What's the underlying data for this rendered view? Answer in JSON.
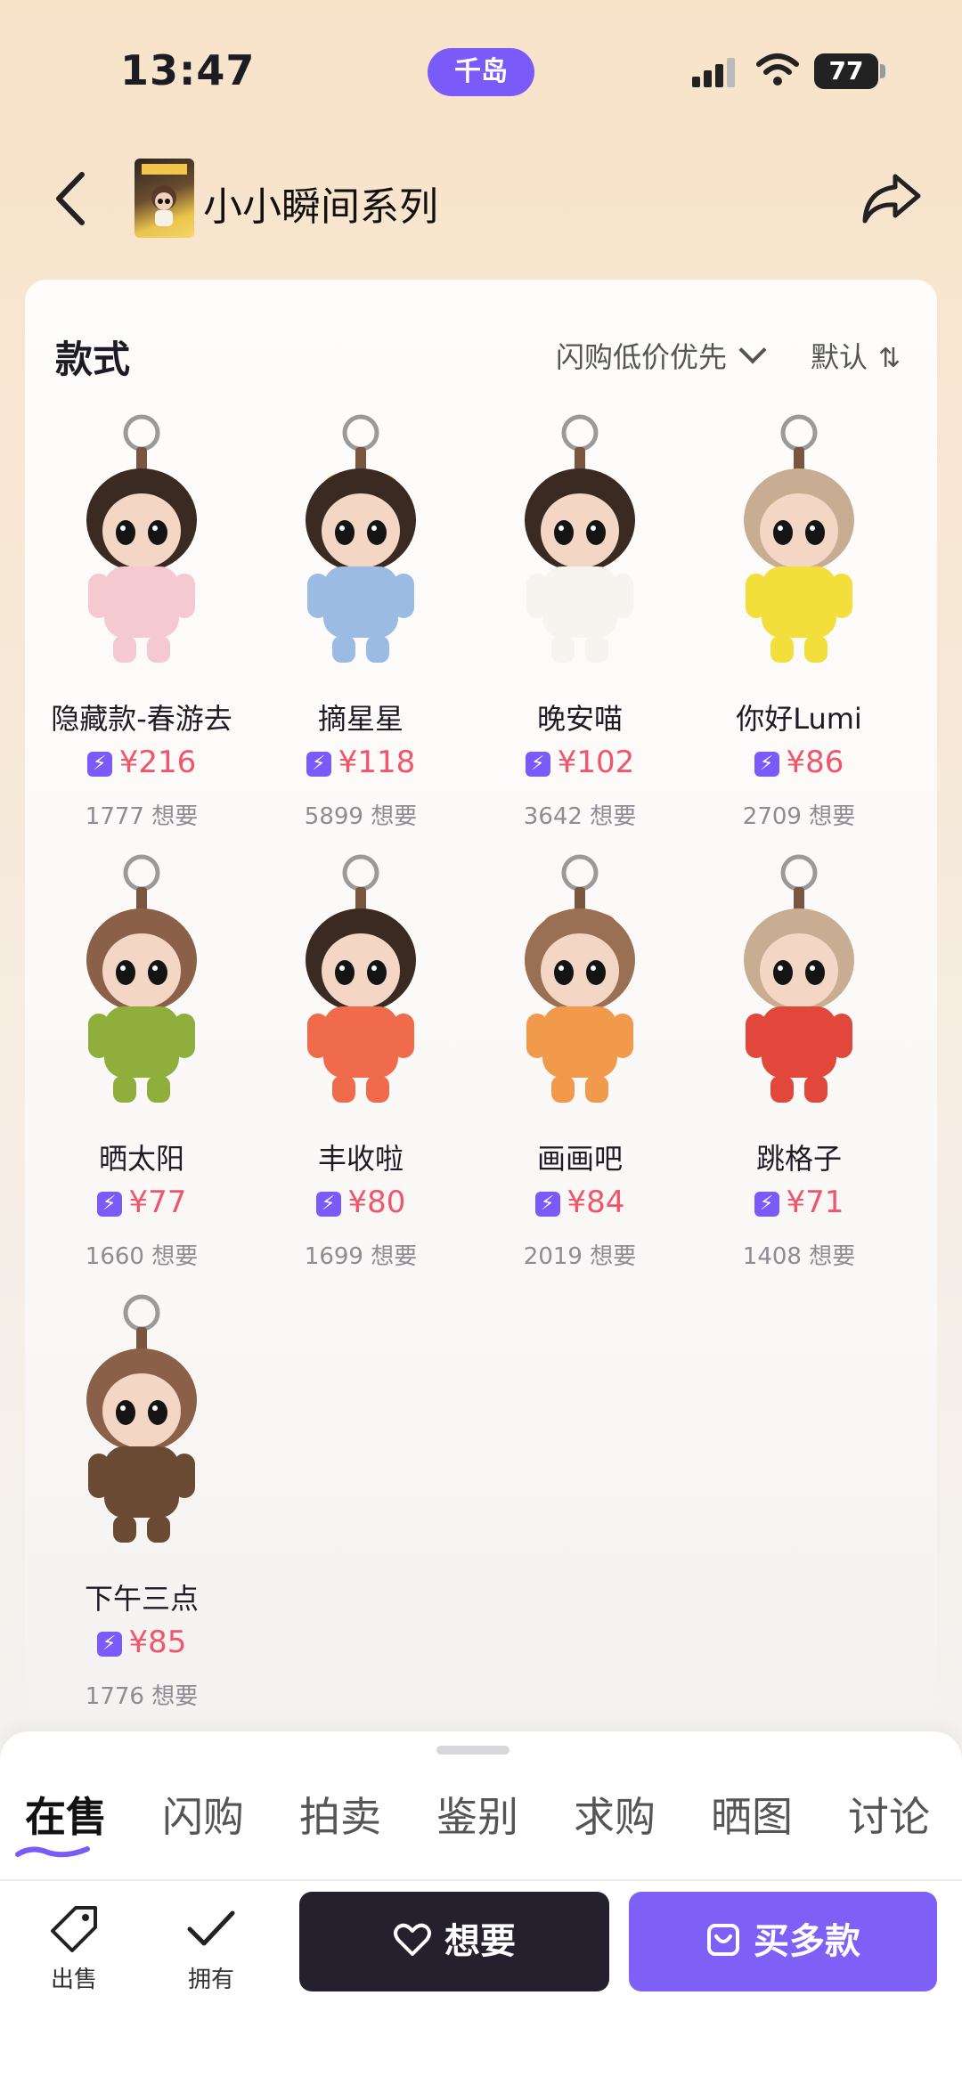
{
  "status_bar": {
    "time": "13:47",
    "app_pill": "千岛",
    "battery": "77"
  },
  "header": {
    "title": "小小瞬间系列"
  },
  "section": {
    "title": "款式",
    "sort_flash_label": "闪购低价优先",
    "sort_default_label": "默认",
    "sort_default_icon": "⇅"
  },
  "items": [
    {
      "name": "隐藏款-春游去",
      "price": "¥216",
      "wants": "1777 想要",
      "hair": "#3b2a22",
      "outfit": "#f4c9d2",
      "hat": "#ffffff"
    },
    {
      "name": "摘星星",
      "price": "¥118",
      "wants": "5899 想要",
      "hair": "#3b2a22",
      "outfit": "#9cbbe3",
      "hat": "#f3d233"
    },
    {
      "name": "晚安喵",
      "price": "¥102",
      "wants": "3642 想要",
      "hair": "#3b2a22",
      "outfit": "#f7f4ef",
      "hat": ""
    },
    {
      "name": "你好Lumi",
      "price": "¥86",
      "wants": "2709 想要",
      "hair": "#c9ad93",
      "outfit": "#f2df3c",
      "hat": ""
    },
    {
      "name": "晒太阳",
      "price": "¥77",
      "wants": "1660 想要",
      "hair": "#8a6048",
      "outfit": "#8fae3b",
      "hat": ""
    },
    {
      "name": "丰收啦",
      "price": "¥80",
      "wants": "1699 想要",
      "hair": "#3b2a22",
      "outfit": "#ef6b4b",
      "hat": ""
    },
    {
      "name": "画画吧",
      "price": "¥84",
      "wants": "2019 想要",
      "hair": "#9a7055",
      "outfit": "#f19a4c",
      "hat": "#e0352b"
    },
    {
      "name": "跳格子",
      "price": "¥71",
      "wants": "1408 想要",
      "hair": "#c9ad93",
      "outfit": "#e2473b",
      "hat": ""
    },
    {
      "name": "下午三点",
      "price": "¥85",
      "wants": "1776 想要",
      "hair": "#8a6048",
      "outfit": "#6a4a33",
      "hat": ""
    }
  ],
  "tabs": [
    {
      "label": "在售",
      "active": true
    },
    {
      "label": "闪购",
      "active": false
    },
    {
      "label": "拍卖",
      "active": false
    },
    {
      "label": "鉴别",
      "active": false
    },
    {
      "label": "求购",
      "active": false
    },
    {
      "label": "晒图",
      "active": false
    },
    {
      "label": "讨论",
      "active": false
    }
  ],
  "bottom_bar": {
    "sell_label": "出售",
    "own_label": "拥有",
    "want_label": "想要",
    "buy_label": "买多款"
  },
  "colors": {
    "accent": "#7a5af8",
    "price": "#f0556a",
    "dark_button": "#24202e"
  }
}
